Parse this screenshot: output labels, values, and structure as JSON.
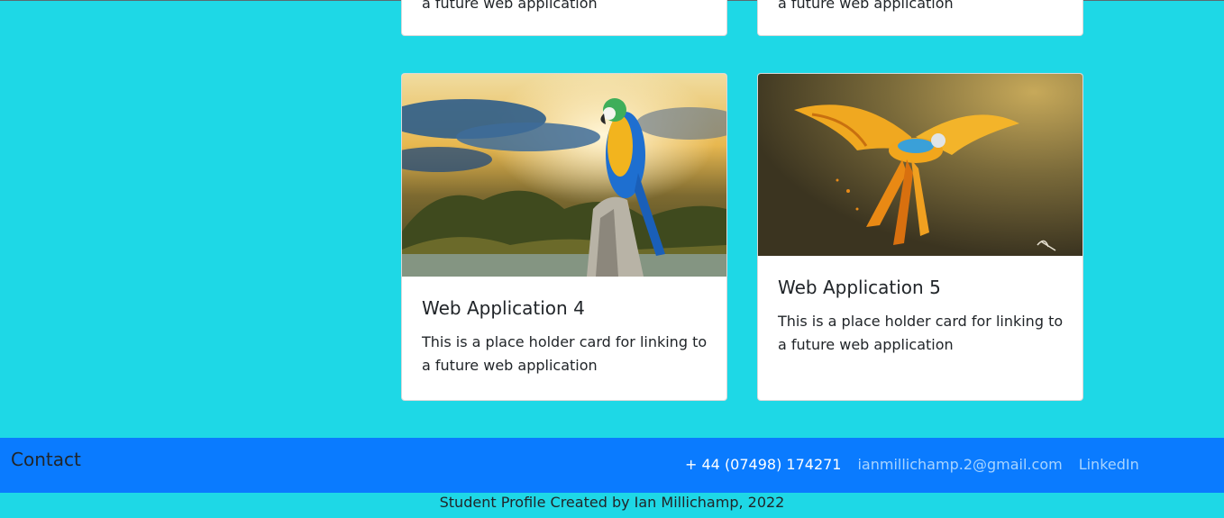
{
  "cards_top": [
    {
      "text": "a future web application"
    },
    {
      "text": "a future web application"
    }
  ],
  "cards": [
    {
      "title": "Web Application 4",
      "text": "This is a place holder card for linking to a future web application",
      "image_alt": "Blue and yellow macaw perched on a rock"
    },
    {
      "title": "Web Application 5",
      "text": "This is a place holder card for linking to a future web application",
      "image_alt": "Orange macaw in flight"
    }
  ],
  "footer": {
    "contact_heading": "Contact",
    "phone": "+ 44 (07498) 174271",
    "email": "ianmillichamp.2@gmail.com",
    "linkedin": "LinkedIn"
  },
  "credit": "Student Profile Created by Ian Millichamp, 2022",
  "colors": {
    "page_bg": "#1ed8e6",
    "footer_bg": "#0a7bff",
    "link": "#a8d4ff"
  }
}
